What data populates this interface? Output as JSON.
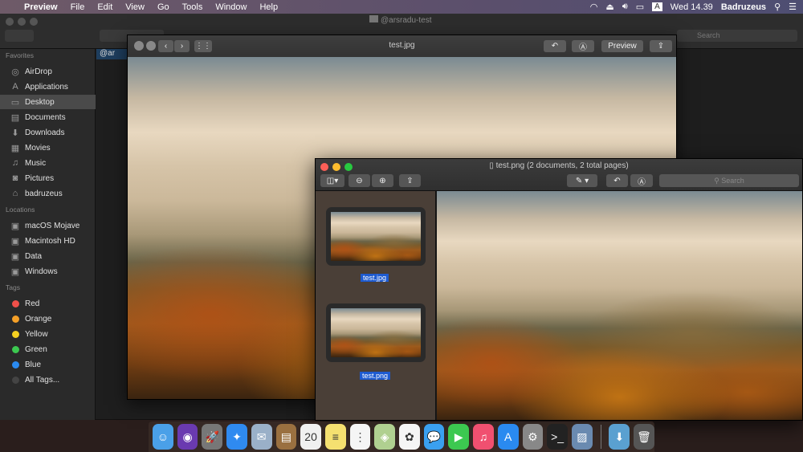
{
  "menubar": {
    "apple": "",
    "app": "Preview",
    "items": [
      "File",
      "Edit",
      "View",
      "Go",
      "Tools",
      "Window",
      "Help"
    ],
    "clock": "Wed 14.39",
    "user": "Badruzeus",
    "input": "A"
  },
  "finder": {
    "title": "@arsradu-test",
    "search_placeholder": "Search",
    "selected_item": "@ar",
    "sections": [
      {
        "header": "Favorites",
        "items": [
          {
            "label": "AirDrop",
            "icon": "airdrop-icon",
            "glyph": "◎"
          },
          {
            "label": "Applications",
            "icon": "applications-icon",
            "glyph": "A"
          },
          {
            "label": "Desktop",
            "icon": "desktop-icon",
            "glyph": "▭",
            "selected": true
          },
          {
            "label": "Documents",
            "icon": "documents-icon",
            "glyph": "▤"
          },
          {
            "label": "Downloads",
            "icon": "downloads-icon",
            "glyph": "⬇"
          },
          {
            "label": "Movies",
            "icon": "movies-icon",
            "glyph": "▦"
          },
          {
            "label": "Music",
            "icon": "music-icon",
            "glyph": "♫"
          },
          {
            "label": "Pictures",
            "icon": "camera-icon",
            "glyph": "◙"
          },
          {
            "label": "badruzeus",
            "icon": "home-icon",
            "glyph": "⌂"
          }
        ]
      },
      {
        "header": "Locations",
        "items": [
          {
            "label": "macOS Mojave",
            "icon": "disk-icon",
            "glyph": "▣"
          },
          {
            "label": "Macintosh HD",
            "icon": "disk-icon",
            "glyph": "▣"
          },
          {
            "label": "Data",
            "icon": "disk-icon",
            "glyph": "▣"
          },
          {
            "label": "Windows",
            "icon": "disk-icon",
            "glyph": "▣"
          }
        ]
      },
      {
        "header": "Tags",
        "items": [
          {
            "label": "Red",
            "color": "#f0504a"
          },
          {
            "label": "Orange",
            "color": "#f5a028"
          },
          {
            "label": "Yellow",
            "color": "#f5d020"
          },
          {
            "label": "Green",
            "color": "#3cc850"
          },
          {
            "label": "Blue",
            "color": "#2a8af0"
          },
          {
            "label": "All Tags...",
            "color": "#444"
          }
        ]
      }
    ]
  },
  "preview1": {
    "title": "test.jpg",
    "preview_label": "Preview"
  },
  "preview2": {
    "title": "test.png (2 documents, 2 total pages)",
    "search_placeholder": "Search",
    "thumbnails": [
      "test.jpg",
      "test.png"
    ]
  },
  "dock": [
    {
      "name": "finder",
      "bg": "#4aa0e8",
      "g": "☺"
    },
    {
      "name": "siri",
      "bg": "#6a3ab0",
      "g": "◉"
    },
    {
      "name": "launchpad",
      "bg": "#777",
      "g": "🚀"
    },
    {
      "name": "safari",
      "bg": "#2f8af0",
      "g": "✦"
    },
    {
      "name": "mail",
      "bg": "#9ab0c8",
      "g": "✉"
    },
    {
      "name": "contacts",
      "bg": "#9a7040",
      "g": "▤"
    },
    {
      "name": "calendar",
      "bg": "#f0f0f0",
      "g": "20"
    },
    {
      "name": "notes",
      "bg": "#f5e070",
      "g": "≡"
    },
    {
      "name": "reminders",
      "bg": "#f5f5f5",
      "g": "⋮"
    },
    {
      "name": "maps",
      "bg": "#b0d090",
      "g": "◈"
    },
    {
      "name": "photos",
      "bg": "#f5f5f5",
      "g": "✿"
    },
    {
      "name": "messages",
      "bg": "#3aa0f0",
      "g": "💬"
    },
    {
      "name": "facetime",
      "bg": "#3cc850",
      "g": "▶"
    },
    {
      "name": "itunes",
      "bg": "#f05070",
      "g": "♫"
    },
    {
      "name": "app-store",
      "bg": "#2a8af0",
      "g": "A"
    },
    {
      "name": "system-preferences",
      "bg": "#888",
      "g": "⚙"
    },
    {
      "name": "terminal",
      "bg": "#222",
      "g": ">_"
    },
    {
      "name": "preview",
      "bg": "#6a8ab0",
      "g": "▨"
    }
  ],
  "dock_right": [
    {
      "name": "downloads-folder",
      "bg": "#5aa0d0",
      "g": "⬇"
    },
    {
      "name": "trash",
      "bg": "#555",
      "g": "🗑"
    }
  ]
}
